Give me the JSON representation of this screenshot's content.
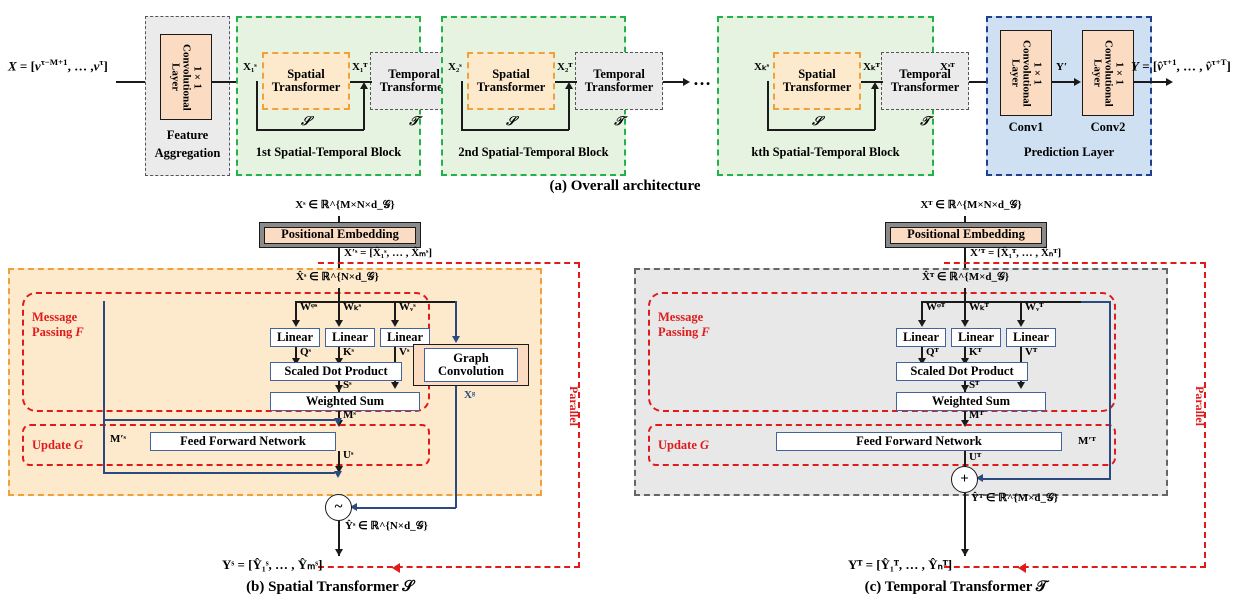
{
  "figure": {
    "panels": [
      {
        "id": "a",
        "caption": "(a) Overall architecture"
      },
      {
        "id": "b",
        "caption": "(b) Spatial Transformer 𝒮"
      },
      {
        "id": "c",
        "caption": "(c) Temporal Transformer 𝒯"
      }
    ]
  },
  "colors": {
    "green_block": "#e7f3e1",
    "green_border": "#22b14c",
    "blue_panel": "#cfe0f3",
    "blue_border": "#1f3f8f",
    "gray_panel": "#e8e8e8",
    "peach_box": "#fbdcc2",
    "orange_dash": "#f0a13c",
    "yellow_panel": "#fdeacd",
    "red_accent": "#e01b1b",
    "navy_line": "#2b4a80"
  },
  "overall": {
    "input_label": "X = [vᵀ⁻ᴹ⁺¹, … , vᵀ]",
    "output_label": "Y = [v̂ᵀ⁺¹, … , v̂ᵀ⁺ᵀ]",
    "feature_aggregation": {
      "panel_label_line1": "Feature",
      "panel_label_line2": "Aggregation",
      "conv_label": "1×1 Convolutional Layer"
    },
    "blocks": [
      {
        "title": "1st Spatial-Temporal Block",
        "spatial_in": "X₁ˢ",
        "spatial_label_line1": "Spatial",
        "spatial_label_line2": "Transformer",
        "spatial_symbol": "𝒮",
        "temporal_in": "X₁ᵀ",
        "temporal_label_line1": "Temporal",
        "temporal_label_line2": "Transformer",
        "temporal_symbol": "𝒯"
      },
      {
        "title": "2nd Spatial-Temporal Block",
        "spatial_in": "X₂ˢ",
        "spatial_label_line1": "Spatial",
        "spatial_label_line2": "Transformer",
        "spatial_symbol": "𝒮",
        "temporal_in": "X₂ᵀ",
        "temporal_label_line1": "Temporal",
        "temporal_label_line2": "Transformer",
        "temporal_symbol": "𝒯"
      },
      {
        "title": "kth Spatial-Temporal Block",
        "spatial_in": "Xₖˢ",
        "spatial_label_line1": "Spatial",
        "spatial_label_line2": "Transformer",
        "spatial_symbol": "𝒮",
        "temporal_in": "Xₖᵀ",
        "temporal_label_line1": "Temporal",
        "temporal_label_line2": "Transformer",
        "temporal_symbol": "𝒯"
      }
    ],
    "ellipsis": "…",
    "prediction": {
      "panel_label": "Prediction Layer",
      "input_label": "Xˢᵀ",
      "mid_label": "Y′",
      "conv1": {
        "name": "Conv1",
        "text": "1×1 Convolutional Layer"
      },
      "conv2": {
        "name": "Conv2",
        "text": "1×1 Convolutional Layer"
      }
    }
  },
  "spatial": {
    "input_tensor": "Xˢ ∈ ℝ^{M×N×d_𝒢}",
    "positional_embedding": "Positional Embedding",
    "after_pe": "X′ˢ = [X̂₁ˢ, … , X̂ₘˢ]",
    "hat_tensor": "X̂ˢ ∈ ℝ^{N×d_𝒢}",
    "message_passing": "Message Passing F",
    "update": "Update G",
    "parallel": "Parallel",
    "weights": [
      "Wᵠˢ",
      "Wₖˢ",
      "Wᵥˢ"
    ],
    "linear": [
      "Linear",
      "Linear",
      "Linear"
    ],
    "qkv": [
      "Qˢ",
      "Kˢ",
      "Vˢ"
    ],
    "scaled_dot": "Scaled Dot Product",
    "score": "Sˢ",
    "weighted_sum": "Weighted Sum",
    "message": "Mˢ",
    "message_res": "M′ˢ",
    "ffn": "Feed Forward Network",
    "update_out": "Uˢ",
    "graph_conv_line1": "Graph",
    "graph_conv_line2": "Convolution",
    "graph_out": "Xᵍ",
    "merge_op": "~",
    "out_hat": "Ŷˢ ∈ ℝ^{N×d_𝒢}",
    "out_label": "Yˢ = [Ŷ₁ˢ, … , Ŷₘˢ]"
  },
  "temporal": {
    "input_tensor": "Xᵀ ∈ ℝ^{M×N×d_𝒢}",
    "positional_embedding": "Positional Embedding",
    "after_pe": "X′ᵀ = [X̂₁ᵀ, … , X̂ₙᵀ]",
    "hat_tensor": "X̂ᵀ ∈ ℝ^{M×d_𝒢}",
    "message_passing": "Message Passing F",
    "update": "Update G",
    "parallel": "Parallel",
    "weights": [
      "Wᵠᵀ",
      "Wₖᵀ",
      "Wᵥᵀ"
    ],
    "linear": [
      "Linear",
      "Linear",
      "Linear"
    ],
    "qkv": [
      "Qᵀ",
      "Kᵀ",
      "Vᵀ"
    ],
    "scaled_dot": "Scaled Dot Product",
    "score": "Sᵀ",
    "weighted_sum": "Weighted Sum",
    "message": "Mᵀ",
    "message_res": "M′ᵀ",
    "ffn": "Feed Forward Network",
    "update_out": "Uᵀ",
    "merge_op": "+",
    "out_hat": "Ŷᵀ ∈ ℝ^{M×d_𝒢}",
    "out_label": "Yᵀ = [Ŷ₁ᵀ, … , Ŷₙᵀ]"
  }
}
